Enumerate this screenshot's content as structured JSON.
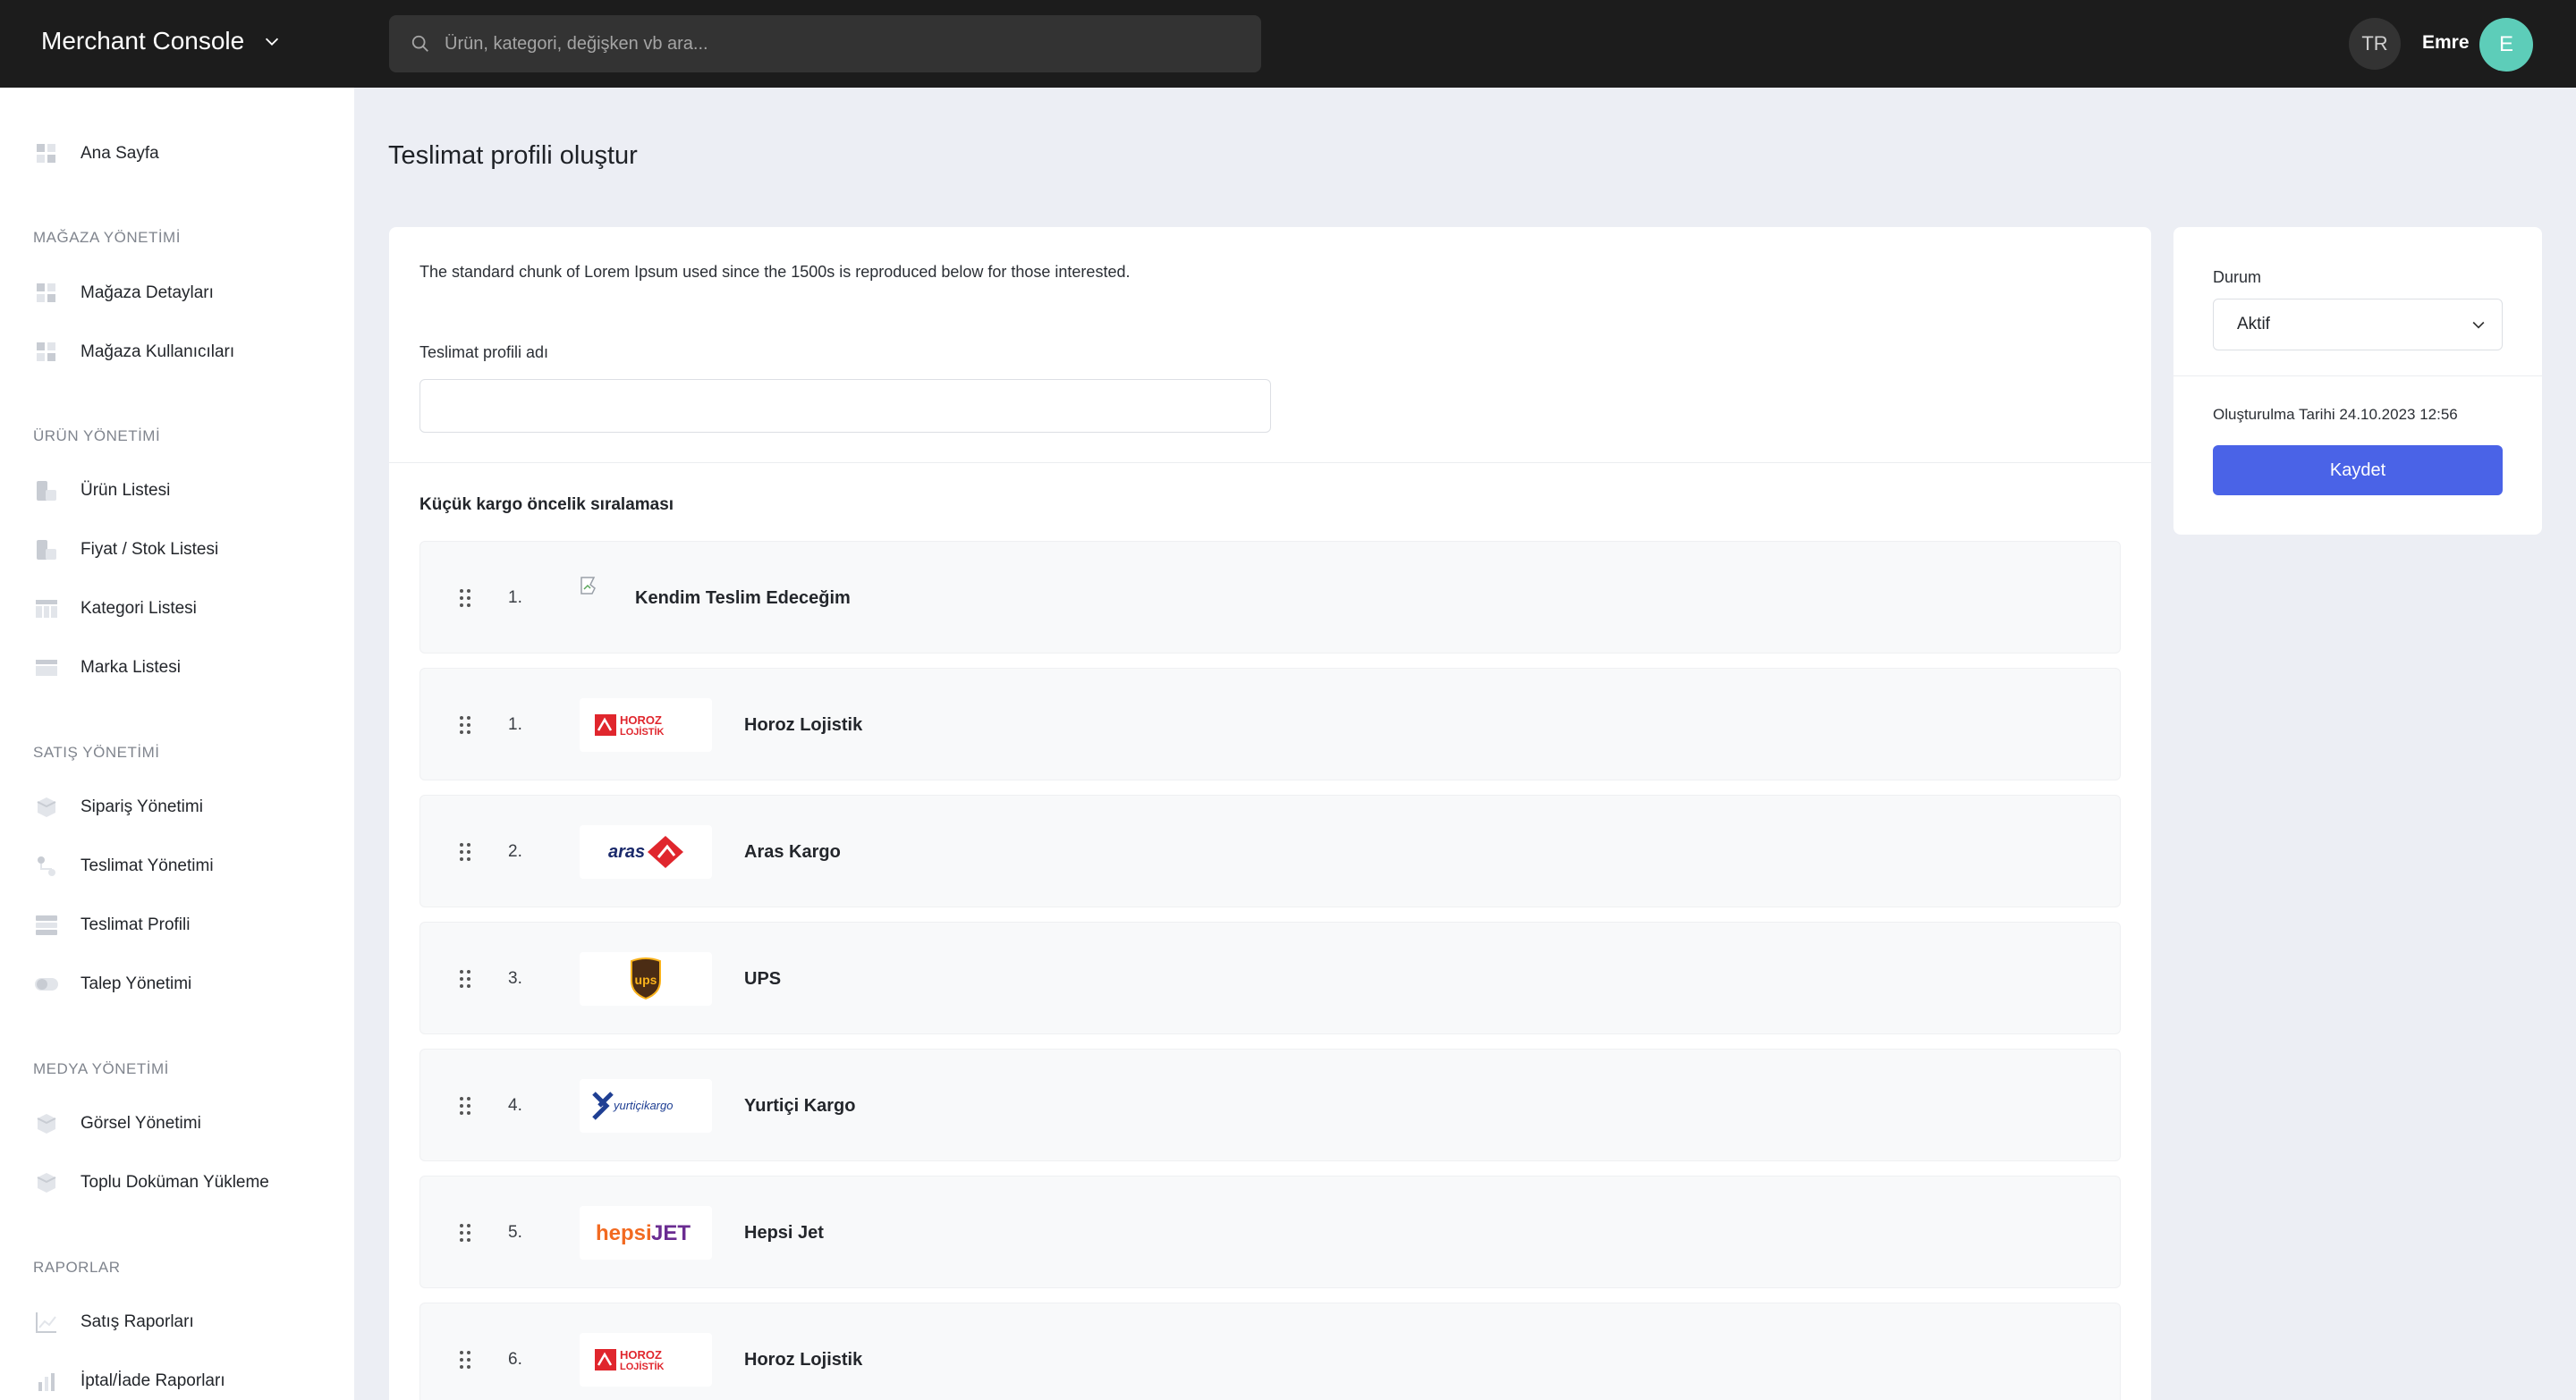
{
  "header": {
    "app_title": "Merchant Console",
    "search_placeholder": "Ürün, kategori, değişken vb ara...",
    "language": "TR",
    "user_name": "Emre",
    "user_initial": "E",
    "avatar_color": "#5dcdb9"
  },
  "sidebar": {
    "home": "Ana Sayfa",
    "sections": [
      {
        "title": "MAĞAZA YÖNETİMİ",
        "items": [
          "Mağaza Detayları",
          "Mağaza Kullanıcıları"
        ]
      },
      {
        "title": "ÜRÜN YÖNETİMİ",
        "items": [
          "Ürün Listesi",
          "Fiyat / Stok Listesi",
          "Kategori Listesi",
          "Marka Listesi"
        ]
      },
      {
        "title": "SATIŞ YÖNETİMİ",
        "items": [
          "Sipariş Yönetimi",
          "Teslimat Yönetimi",
          "Teslimat Profili",
          "Talep Yönetimi"
        ]
      },
      {
        "title": "MEDYA YÖNETİMİ",
        "items": [
          "Görsel Yönetimi",
          "Toplu Doküman Yükleme"
        ]
      },
      {
        "title": "RAPORLAR",
        "items": [
          "Satış Raporları",
          "İptal/İade Raporları"
        ]
      }
    ]
  },
  "page": {
    "title": "Teslimat profili oluştur",
    "description": "The standard chunk of Lorem Ipsum used since the 1500s is reproduced below for those interested.",
    "profile_name_label": "Teslimat profili adı",
    "profile_name_value": "",
    "priority_title": "Küçük kargo öncelik sıralaması",
    "carriers": [
      {
        "rank": "1.",
        "name": "Kendim Teslim Edeceğim",
        "logo": "broken-image"
      },
      {
        "rank": "1.",
        "name": "Horoz Lojistik",
        "logo": "horoz-logo"
      },
      {
        "rank": "2.",
        "name": "Aras Kargo",
        "logo": "aras-logo"
      },
      {
        "rank": "3.",
        "name": "UPS",
        "logo": "ups-logo"
      },
      {
        "rank": "4.",
        "name": "Yurtiçi Kargo",
        "logo": "yurtici-logo"
      },
      {
        "rank": "5.",
        "name": "Hepsi Jet",
        "logo": "hepsijet-logo"
      },
      {
        "rank": "6.",
        "name": "Horoz Lojistik",
        "logo": "horoz-logo"
      }
    ],
    "logo_texts": {
      "horoz_top": "HOROZ",
      "horoz_bottom": "LOJİSTİK",
      "aras": "aras",
      "ups": "ups",
      "yurtici": "yurtiçikargo",
      "hepsi": "hepsi",
      "jet": "JET"
    }
  },
  "side_panel": {
    "status_label": "Durum",
    "status_value": "Aktif",
    "created_label": "Oluşturulma Tarihi 24.10.2023 12:56",
    "save_label": "Kaydet",
    "accent_color": "#4a63e7"
  }
}
